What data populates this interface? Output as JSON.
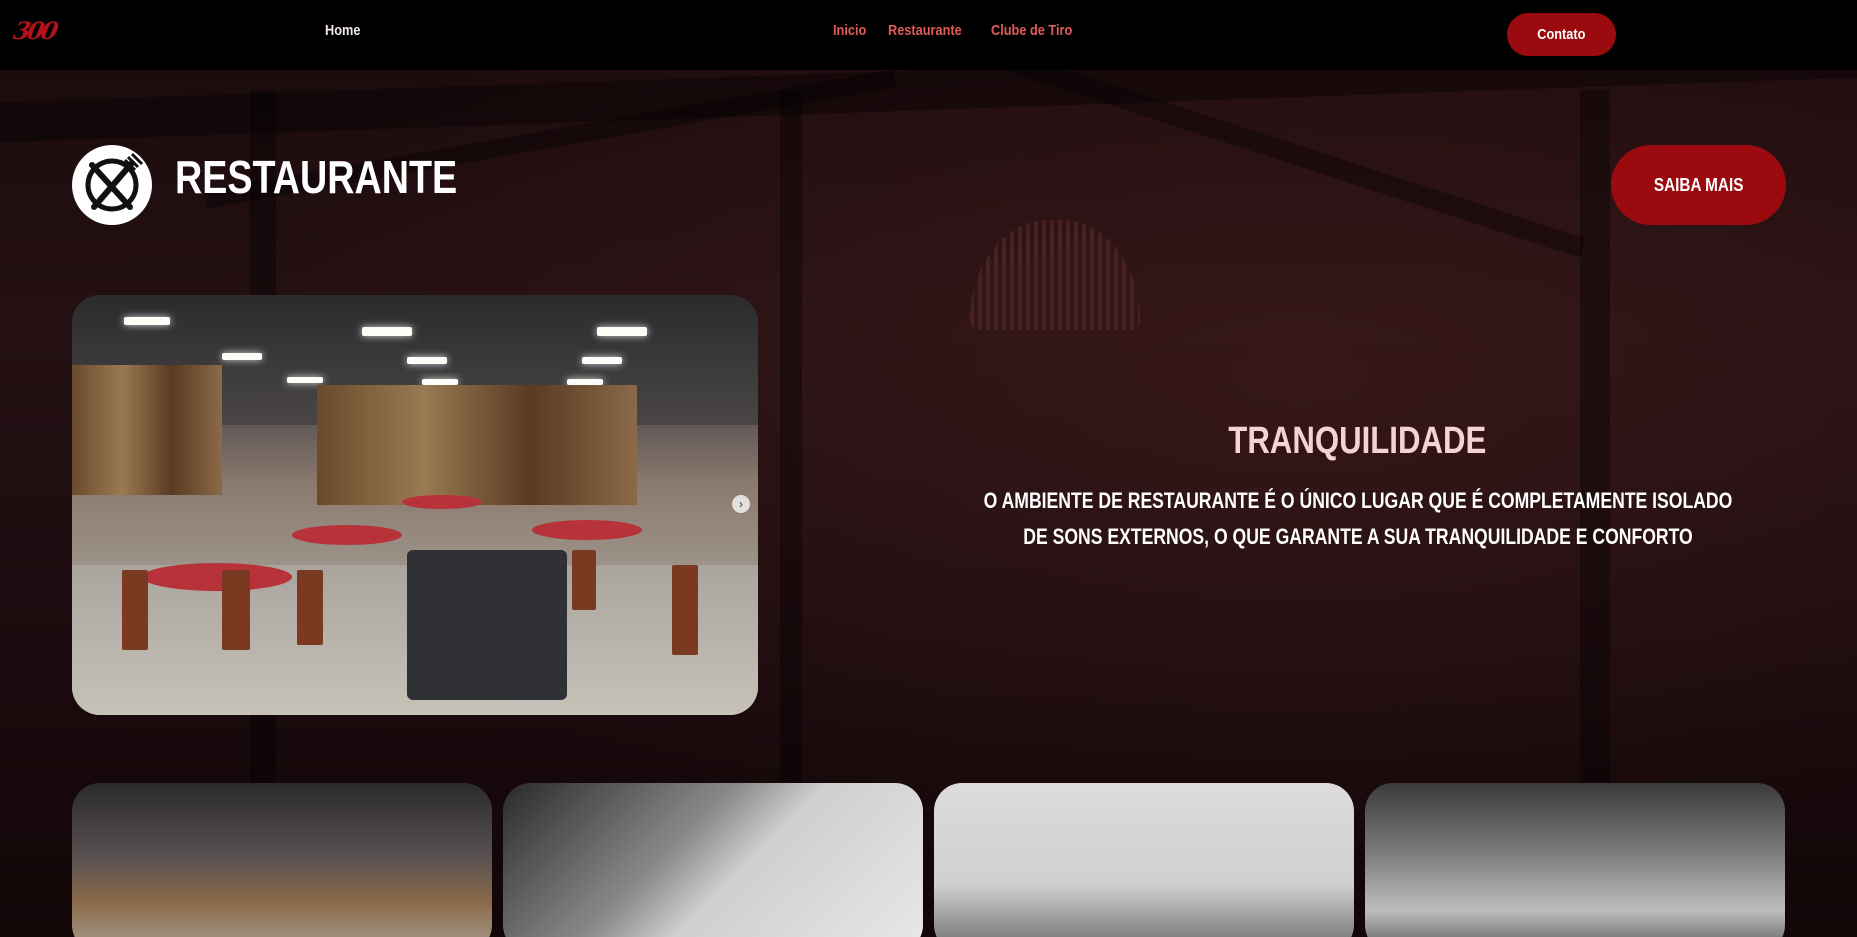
{
  "header": {
    "logo_text": "300",
    "nav_home": "Home",
    "nav_links": [
      "Inicio",
      "Restaurante",
      "Clube de Tiro"
    ],
    "contact_label": "Contato"
  },
  "section": {
    "title": "RESTAURANTE",
    "icon": "fork-knife-plate-icon",
    "cta_label": "SAIBA MAIS"
  },
  "feature": {
    "title": "TRANQUILIDADE",
    "body": "O AMBIENTE DE RESTAURANTE É O ÚNICO LUGAR QUE É COMPLETAMENTE ISOLADO DE SONS EXTERNOS, O QUE GARANTE A SUA TRANQUILIDADE E CONFORTO"
  },
  "carousel": {
    "next_icon": "chevron-right-icon"
  },
  "colors": {
    "brand_red": "#9b0a0e",
    "nav_link": "#e05a5a",
    "feature_title": "#f6d2d2"
  }
}
